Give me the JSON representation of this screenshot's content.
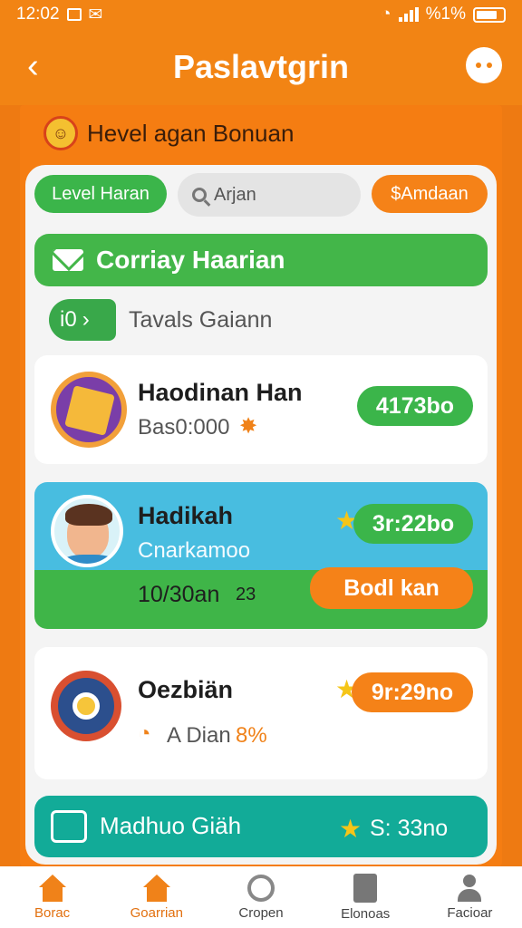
{
  "status": {
    "time": "12:02",
    "battery": "%1%"
  },
  "appbar": {
    "back_icon": "chevron-left-icon",
    "title": "Paslavtgrin",
    "action_icon": "mascot-icon"
  },
  "header": {
    "title": "Hevel agan Bonuan"
  },
  "filters": {
    "level": "Level Haran",
    "search_text": "Arjan",
    "action": "$Amdaan"
  },
  "banner": {
    "label": "Corriay Haarian"
  },
  "subheader": {
    "count": "i0",
    "label": "Tavals Gaiann"
  },
  "cards": [
    {
      "title": "Haodinan Han",
      "subtitle": "Bas0:000",
      "value": "4173bo",
      "color": "#3bb54a"
    },
    {
      "title": "Hadikah",
      "subtitle": "Cnarkamoo",
      "value": "3r:22bo",
      "progress": "10/30an",
      "progress_extra": "23",
      "button": "Bodl kan",
      "color": "#3bb54a",
      "button_color": "#f58218"
    },
    {
      "title": "Oezbiän",
      "subtitle": "A Dian",
      "percent": "8%",
      "value": "9r:29no",
      "color": "#f58218"
    },
    {
      "title": "Madhuo Giäh",
      "value": "S: 33no"
    }
  ],
  "tabs": [
    {
      "label": "Borac",
      "icon": "home-icon"
    },
    {
      "label": "Goarrian",
      "icon": "home-icon"
    },
    {
      "label": "Cropen",
      "icon": "compass-icon"
    },
    {
      "label": "Elonoas",
      "icon": "document-icon"
    },
    {
      "label": "Facioar",
      "icon": "user-icon"
    }
  ]
}
